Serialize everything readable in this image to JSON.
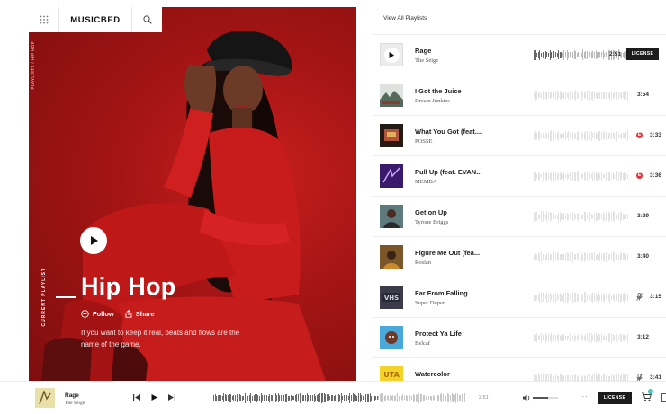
{
  "header": {
    "logo": "MUSICBED"
  },
  "hero": {
    "side_label": "PLAYLISTS / HIP HOP",
    "section_label": "CURRENT PLAYLIST",
    "title": "Hip Hop",
    "follow_label": "Follow",
    "share_label": "Share",
    "description": "If you want to keep it real, beats and flows are the name of the game."
  },
  "list": {
    "view_all": "View All Playlists",
    "license_label": "LICENSE",
    "tracks": [
      {
        "title": "Rage",
        "artist": "The Seige",
        "duration": "2:51"
      },
      {
        "title": "I Got the Juice",
        "artist": "Dream Junkies",
        "duration": "3:54"
      },
      {
        "title": "What You Got (feat....",
        "artist": "POSSE",
        "duration": "3:33",
        "badge": "E"
      },
      {
        "title": "Pull Up (feat. EVAN...",
        "artist": "MEMBA",
        "duration": "3:36",
        "badge": "E"
      },
      {
        "title": "Get on Up",
        "artist": "Tyrone Briggs",
        "duration": "3:29"
      },
      {
        "title": "Figure Me Out (fea...",
        "artist": "Roslan",
        "duration": "3:40"
      },
      {
        "title": "Far From Falling",
        "artist": "Super Duper",
        "duration": "3:15"
      },
      {
        "title": "Protect Ya Life",
        "artist": "Belcaf",
        "duration": "3:12"
      },
      {
        "title": "Watercolor",
        "artist": "",
        "duration": "3:41"
      }
    ]
  },
  "player": {
    "title": "Rage",
    "artist": "The Seige",
    "time": "2:51",
    "progress": 0.65,
    "volume": 0.6,
    "license_label": "LICENSE",
    "cart_count": "1",
    "more": "···"
  },
  "colors": {
    "hero_red": "#b51919",
    "dark_button": "#1c1c1c",
    "explicit_badge": "#e0343f",
    "cart_badge": "#2ec4b6"
  }
}
